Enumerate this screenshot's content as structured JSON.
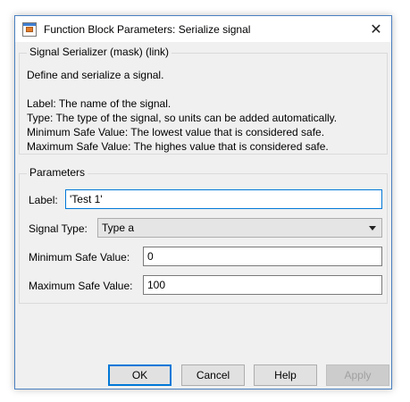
{
  "window": {
    "title": "Function Block Parameters: Serialize signal",
    "close_glyph": "✕"
  },
  "mask": {
    "header": "Signal Serializer (mask) (link)",
    "description_lines": [
      "Define and serialize a signal.",
      "",
      "Label: The name of the signal.",
      "Type: The type of the signal, so units can be added automatically.",
      "Minimum Safe Value: The lowest value that is considered safe.",
      "Maximum Safe Value: The highes value that is considered safe."
    ]
  },
  "parameters": {
    "header": "Parameters",
    "label": {
      "caption": "Label:",
      "value": "'Test 1'"
    },
    "signal_type": {
      "caption": "Signal Type:",
      "value": "Type a"
    },
    "min_safe": {
      "caption": "Minimum Safe Value:",
      "value": "0"
    },
    "max_safe": {
      "caption": "Maximum Safe Value:",
      "value": "100"
    }
  },
  "buttons": {
    "ok": "OK",
    "cancel": "Cancel",
    "help": "Help",
    "apply": "Apply"
  },
  "colors": {
    "accent": "#0078d7",
    "window_border": "#4a7fc0",
    "dialog_bg": "#f0f0f0"
  }
}
